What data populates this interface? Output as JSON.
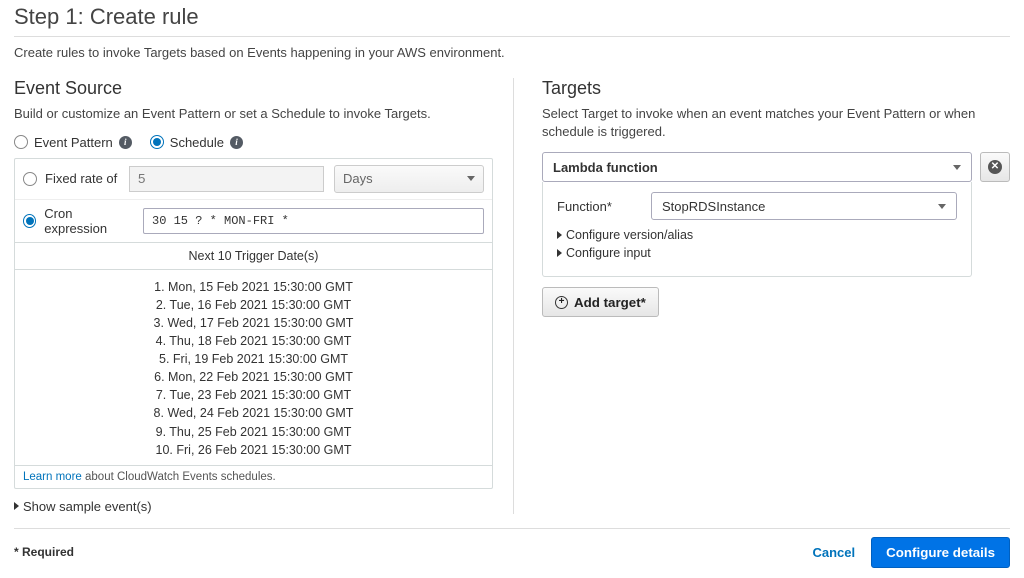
{
  "page": {
    "title": "Step 1: Create rule",
    "subtitle": "Create rules to invoke Targets based on Events happening in your AWS environment."
  },
  "eventSource": {
    "heading": "Event Source",
    "desc": "Build or customize an Event Pattern or set a Schedule to invoke Targets.",
    "mode": {
      "eventPatternLabel": "Event Pattern",
      "scheduleLabel": "Schedule",
      "selected": "schedule"
    },
    "fixedRate": {
      "label": "Fixed rate of",
      "value": "5",
      "unit": "Days"
    },
    "cron": {
      "label": "Cron expression",
      "value": "30 15 ? * MON-FRI *"
    },
    "triggersHeader": "Next 10 Trigger Date(s)",
    "triggers": [
      "1. Mon, 15 Feb 2021 15:30:00 GMT",
      "2. Tue, 16 Feb 2021 15:30:00 GMT",
      "3. Wed, 17 Feb 2021 15:30:00 GMT",
      "4. Thu, 18 Feb 2021 15:30:00 GMT",
      "5. Fri, 19 Feb 2021 15:30:00 GMT",
      "6. Mon, 22 Feb 2021 15:30:00 GMT",
      "7. Tue, 23 Feb 2021 15:30:00 GMT",
      "8. Wed, 24 Feb 2021 15:30:00 GMT",
      "9. Thu, 25 Feb 2021 15:30:00 GMT",
      "10. Fri, 26 Feb 2021 15:30:00 GMT"
    ],
    "learnMore": {
      "linkText": "Learn more",
      "suffix": " about CloudWatch Events schedules."
    },
    "sampleEvents": "Show sample event(s)"
  },
  "targets": {
    "heading": "Targets",
    "desc": "Select Target to invoke when an event matches your Event Pattern or when schedule is triggered.",
    "typeSelected": "Lambda function",
    "functionLabel": "Function*",
    "functionSelected": "StopRDSInstance",
    "configureVersion": "Configure version/alias",
    "configureInput": "Configure input",
    "addTarget": "Add target*"
  },
  "footer": {
    "required": "* Required",
    "cancel": "Cancel",
    "configure": "Configure details"
  }
}
